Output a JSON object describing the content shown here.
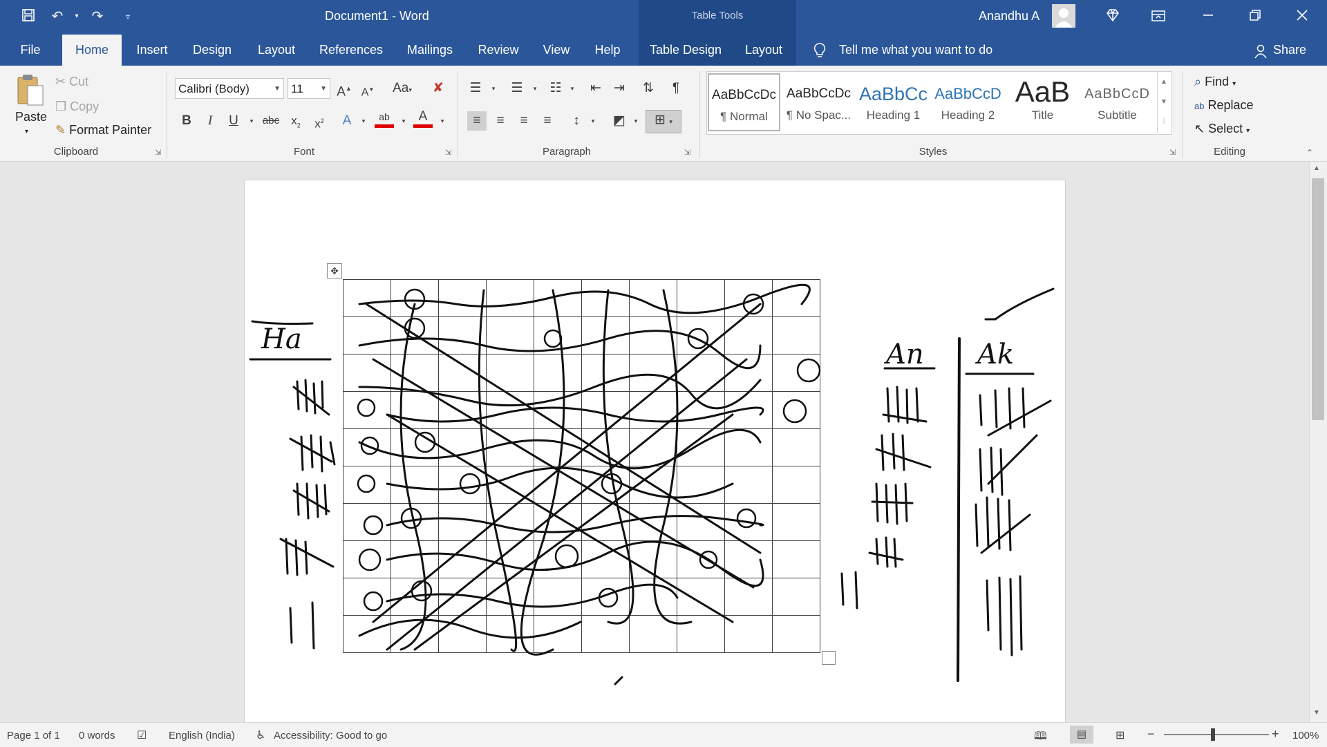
{
  "titlebar": {
    "doc_title": "Document1  -  Word",
    "context_title": "Table Tools",
    "user_name": "Anandhu A",
    "colors": {
      "titlebar_bg": "#2b579a",
      "context_bg": "#204a87"
    }
  },
  "tabs": [
    "File",
    "Home",
    "Insert",
    "Design",
    "Layout",
    "References",
    "Mailings",
    "Review",
    "View",
    "Help",
    "Table Design",
    "Layout"
  ],
  "tell_me": "Tell me what you want to do",
  "share": "Share",
  "clipboard": {
    "paste": "Paste",
    "cut": "Cut",
    "copy": "Copy",
    "format_painter": "Format Painter",
    "label": "Clipboard"
  },
  "font": {
    "name": "Calibri (Body)",
    "size": "11",
    "label": "Font"
  },
  "paragraph": {
    "label": "Paragraph"
  },
  "styles": {
    "label": "Styles",
    "items": [
      {
        "sample": "AaBbCcDc",
        "name": "¶ Normal"
      },
      {
        "sample": "AaBbCcDc",
        "name": "¶ No Spac..."
      },
      {
        "sample": "AaBbCc",
        "name": "Heading 1"
      },
      {
        "sample": "AaBbCcD",
        "name": "Heading 2"
      },
      {
        "sample": "AaB",
        "name": "Title"
      },
      {
        "sample": "AaBbCcD",
        "name": "Subtitle"
      }
    ]
  },
  "editing": {
    "find": "Find",
    "replace": "Replace",
    "select": "Select",
    "label": "Editing"
  },
  "document": {
    "ink_labels": {
      "left": "Ha",
      "right1": "An",
      "right2": "Ak"
    }
  },
  "statusbar": {
    "page": "Page 1 of 1",
    "words": "0 words",
    "language": "English (India)",
    "accessibility": "Accessibility: Good to go",
    "zoom": "100%"
  }
}
